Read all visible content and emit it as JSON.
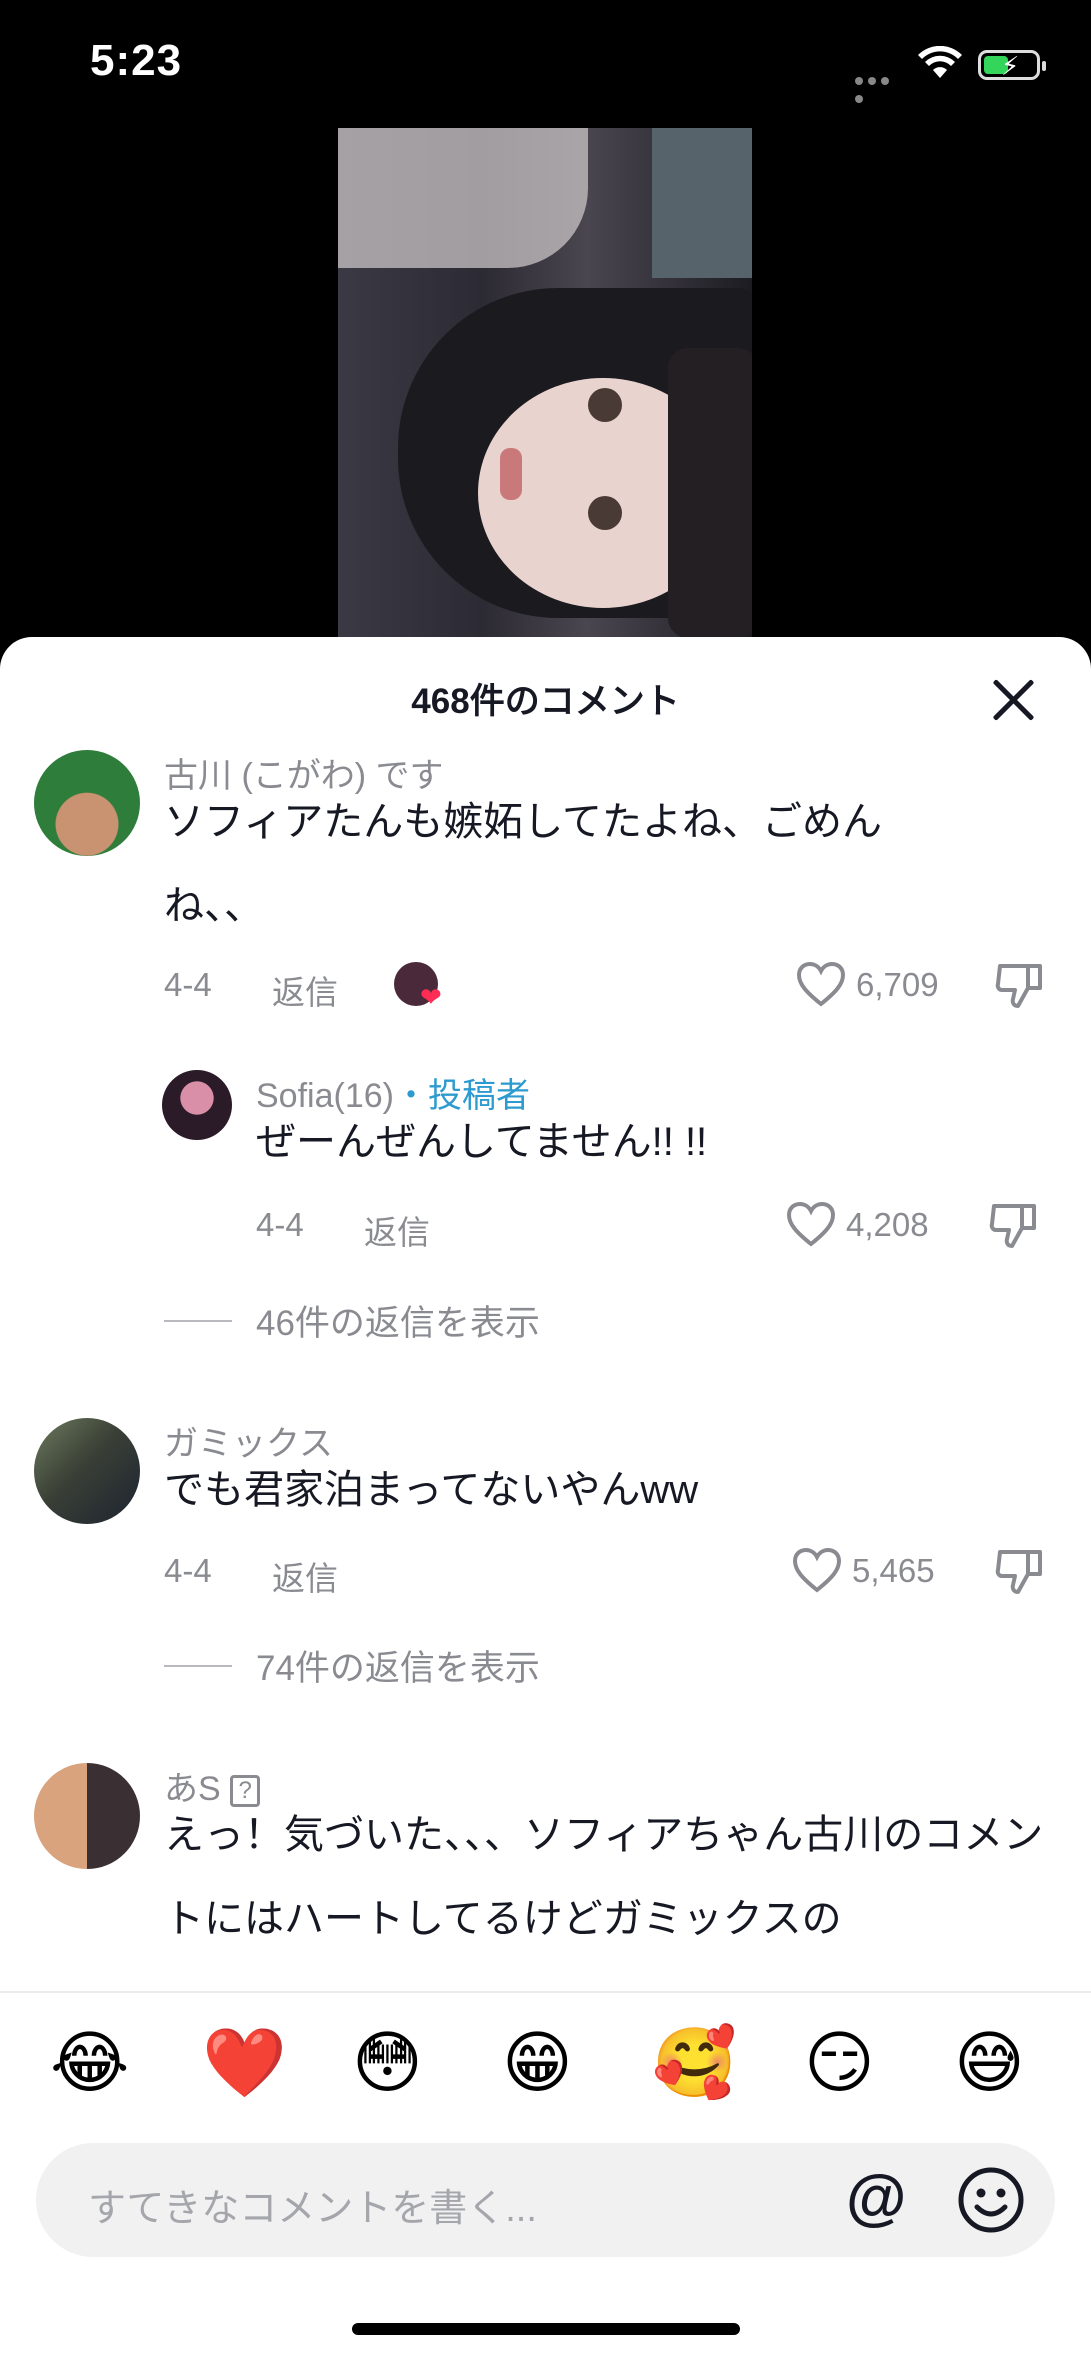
{
  "status_bar": {
    "time": "5:23"
  },
  "sheet": {
    "title": "468件のコメント"
  },
  "comments": [
    {
      "username": "古川 (こがわ) です",
      "text": "ソフィアたんも嫉妬してたよね、ごめんね、、",
      "date": "4-4",
      "reply_label": "返信",
      "likes": "6,709",
      "liked_by_creator": true
    },
    {
      "username": "Sofia(16)",
      "creator_badge": "・投稿者",
      "text": "ぜーんぜんしてません!! !!",
      "date": "4-4",
      "reply_label": "返信",
      "likes": "4,208"
    },
    {
      "view_replies": "46件の返信を表示"
    },
    {
      "username": "ガミックス",
      "text": "でも君家泊まってないやんww",
      "date": "4-4",
      "reply_label": "返信",
      "likes": "5,465"
    },
    {
      "view_replies": "74件の返信を表示"
    },
    {
      "username": "あS",
      "text": "えっ！気づいた、、、ソフィアちゃん古川のコメントにはハートしてるけどガミックスの"
    }
  ],
  "quick_emojis": [
    "😂",
    "❤️",
    "😳",
    "😁",
    "🥰",
    "😏",
    "😅"
  ],
  "input": {
    "placeholder": "すてきなコメントを書く...",
    "at_label": "@"
  },
  "icons": {
    "heart": "heart-outline-icon",
    "dislike": "thumbs-down-icon",
    "close": "close-icon",
    "emoji": "smiley-icon"
  }
}
